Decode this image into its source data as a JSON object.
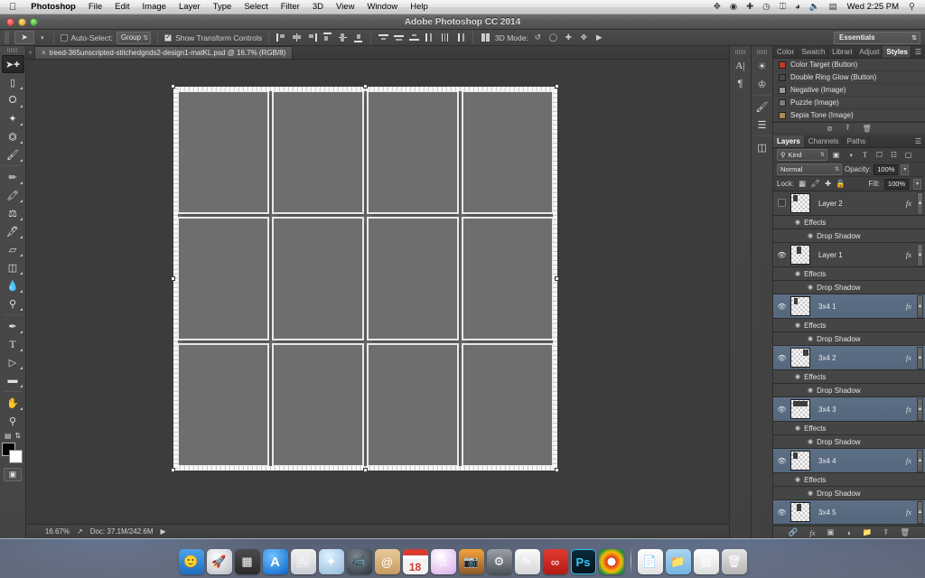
{
  "menubar": {
    "apple": "",
    "items": [
      "Photoshop",
      "File",
      "Edit",
      "Image",
      "Layer",
      "Type",
      "Select",
      "Filter",
      "3D",
      "View",
      "Window",
      "Help"
    ],
    "status_icons": [
      "dropbox-icon",
      "evernote-icon",
      "alfred-icon",
      "timemachine-icon",
      "bluetooth-icon",
      "wifi-icon",
      "volume-icon",
      "battery-icon"
    ],
    "clock": "Wed 2:25 PM",
    "search": "spotlight-search-icon"
  },
  "window": {
    "title": "Adobe Photoshop CC 2014"
  },
  "options_bar": {
    "tool_icon": "move-tool-icon",
    "auto_select_label": "Auto-Select:",
    "auto_select_value": "Group",
    "show_transform_label": "Show Transform Controls",
    "show_transform_checked": true,
    "align_buttons": [
      "align-left-edges",
      "align-horizontal-centers",
      "align-right-edges",
      "align-top-edges",
      "align-vertical-centers",
      "align-bottom-edges",
      "distribute-top-edges",
      "distribute-vertical-centers",
      "distribute-bottom-edges",
      "distribute-left-edges",
      "distribute-horizontal-centers",
      "distribute-right-edges"
    ],
    "mode_3d_label": "3D Mode:",
    "mode_3d_buttons": [
      "rotate-3d-icon",
      "roll-3d-icon",
      "drag-3d-icon",
      "slide-3d-icon",
      "scale-3d-camera-icon"
    ],
    "workspace": "Essentials"
  },
  "document": {
    "tab_title": "treed-365unscripted-stitchedgrids2-design1-matKL.psd @ 16.7% (RGB/8)",
    "close_icon": "close-tab-icon"
  },
  "status_bar": {
    "zoom": "16.67%",
    "share_icon": "share-icon",
    "doc_label": "Doc: 37.1M/242.6M",
    "arrow_icon": "status-expand-arrow-icon"
  },
  "toolbar": {
    "tools": [
      {
        "name": "move-tool",
        "glyph": "➤",
        "active": true
      },
      {
        "name": "rectangular-marquee-tool",
        "glyph": "▭",
        "active": false
      },
      {
        "name": "lasso-tool",
        "glyph": "⟳",
        "active": false
      },
      {
        "name": "quick-selection-tool",
        "glyph": "✦",
        "active": false
      },
      {
        "name": "crop-tool",
        "glyph": "⌗",
        "active": false
      },
      {
        "name": "eyedropper-tool",
        "glyph": "✒",
        "active": false
      },
      {
        "name": "spot-healing-brush-tool",
        "glyph": "✐",
        "active": false
      },
      {
        "name": "brush-tool",
        "glyph": "╱",
        "active": false
      },
      {
        "name": "clone-stamp-tool",
        "glyph": "⚓",
        "active": false
      },
      {
        "name": "history-brush-tool",
        "glyph": "✎",
        "active": false
      },
      {
        "name": "eraser-tool",
        "glyph": "▱",
        "active": false
      },
      {
        "name": "gradient-tool",
        "glyph": "◨",
        "active": false
      },
      {
        "name": "blur-tool",
        "glyph": "●",
        "active": false
      },
      {
        "name": "dodge-tool",
        "glyph": "⚲",
        "active": false
      },
      {
        "name": "pen-tool",
        "glyph": "✒",
        "active": false
      },
      {
        "name": "horizontal-type-tool",
        "glyph": "T",
        "active": false
      },
      {
        "name": "path-selection-tool",
        "glyph": "➤",
        "active": false
      },
      {
        "name": "rectangle-tool",
        "glyph": "▬",
        "active": false
      },
      {
        "name": "hand-tool",
        "glyph": "✋",
        "active": false
      },
      {
        "name": "zoom-tool",
        "glyph": "⌕",
        "active": false
      }
    ],
    "foreground_color": "#000000",
    "background_color": "#ffffff",
    "quick_mask": "quick-mask-mode-icon"
  },
  "minidock": {
    "col1": [
      "character-panel-icon",
      "paragraph-panel-icon"
    ],
    "col2": [
      "adjustments-panel-icon",
      "styles-panel-icon",
      "brush-panel-icon",
      "brush-presets-panel-icon",
      "3d-panel-icon"
    ]
  },
  "styles_panel": {
    "tabs": [
      "Color",
      "Swatch",
      "Librari",
      "Adjust",
      "Styles"
    ],
    "active_tab": "Styles",
    "menu_icon": "panel-menu-icon",
    "items": [
      {
        "label": "Color Target (Button)",
        "color": "#c0392b"
      },
      {
        "label": "Double Ring Glow (Button)",
        "color": "#4a4a4a"
      },
      {
        "label": "Negative (Image)",
        "color": "#9a9a9a"
      },
      {
        "label": "Puzzle (Image)",
        "color": "#7d7d7d"
      },
      {
        "label": "Sepia Tone (Image)",
        "color": "#b08b58"
      }
    ],
    "footer_icons": [
      "no-style-icon",
      "new-style-icon",
      "delete-style-icon"
    ]
  },
  "layers_panel": {
    "tabs": [
      "Layers",
      "Channels",
      "Paths"
    ],
    "active_tab": "Layers",
    "menu_icon": "panel-menu-icon",
    "filter_label": "Kind",
    "filter_icons": [
      "filter-pixel-icon",
      "filter-adjustment-icon",
      "filter-type-icon",
      "filter-shape-icon",
      "filter-smartobject-icon"
    ],
    "blend_mode": "Normal",
    "opacity_label": "Opacity:",
    "opacity_value": "100%",
    "lock_label": "Lock:",
    "lock_icons": [
      "lock-transparent-pixels-icon",
      "lock-image-pixels-icon",
      "lock-position-icon",
      "lock-all-icon"
    ],
    "fill_label": "Fill:",
    "fill_value": "100%",
    "effects_label": "Effects",
    "drop_shadow_label": "Drop Shadow",
    "fx_badge": "fx",
    "layers": [
      {
        "name": "Layer 2",
        "visible": false,
        "selected": false,
        "has_fx": true
      },
      {
        "name": "Layer 1",
        "visible": true,
        "selected": false,
        "has_fx": true
      },
      {
        "name": "3x4 1",
        "visible": true,
        "selected": true,
        "has_fx": true
      },
      {
        "name": "3x4 2",
        "visible": true,
        "selected": true,
        "has_fx": true
      },
      {
        "name": "3x4 3",
        "visible": true,
        "selected": true,
        "has_fx": true
      },
      {
        "name": "3x4 4",
        "visible": true,
        "selected": true,
        "has_fx": true
      },
      {
        "name": "3x4 5",
        "visible": true,
        "selected": true,
        "has_fx": true
      }
    ],
    "footer_icons": [
      "link-layers-icon",
      "add-layer-style-icon",
      "add-layer-mask-icon",
      "new-adjustment-layer-icon",
      "new-group-icon",
      "new-layer-icon",
      "delete-layer-icon"
    ]
  },
  "canvas": {
    "columns": 4,
    "rows": 3,
    "cell_color": "#6e6e6e",
    "border_style": "stitched-white",
    "selection_handles": 8
  },
  "dock": {
    "left_items": [
      {
        "name": "finder",
        "glyph": "🙂",
        "bg": "linear-gradient(180deg,#4aa3e8,#1d6fc0)",
        "running": true
      },
      {
        "name": "launchpad",
        "glyph": "🚀",
        "bg": "radial-gradient(circle at 40% 30%,#fdfdfd,#b9bcc2)",
        "running": false
      },
      {
        "name": "mission-control",
        "glyph": "▦",
        "bg": "linear-gradient(180deg,#4b4b4b,#2b2b2b)",
        "running": false
      },
      {
        "name": "app-store",
        "glyph": "A",
        "bg": "radial-gradient(circle at 38% 28%,#6fc3ff,#0a64c8)",
        "running": false
      },
      {
        "name": "preview",
        "glyph": "🖼",
        "bg": "linear-gradient(180deg,#f2f2f2,#c9ccd2)",
        "running": false
      },
      {
        "name": "safari",
        "glyph": "✦",
        "bg": "radial-gradient(circle at 38% 28%,#dff2ff,#8fb7d6)",
        "running": false
      },
      {
        "name": "facetime",
        "glyph": "📹",
        "bg": "radial-gradient(circle at 38% 28%,#7a8590,#2e3439)",
        "running": false
      },
      {
        "name": "contacts",
        "glyph": "@",
        "bg": "linear-gradient(180deg,#e8c99b,#c79a5e)",
        "running": false
      },
      {
        "name": "calendar",
        "glyph": "18",
        "bg": "linear-gradient(180deg,#ffffff 38%,#f2f2f2 38%)",
        "running": false
      },
      {
        "name": "itunes",
        "glyph": "♫",
        "bg": "radial-gradient(circle at 38% 28%,#ffffff,#d9a8e8)",
        "running": false
      },
      {
        "name": "iphoto",
        "glyph": "📷",
        "bg": "linear-gradient(180deg,#f6a23c,#8a5a2c)",
        "running": false
      },
      {
        "name": "system-preferences",
        "glyph": "⚙",
        "bg": "linear-gradient(180deg,#9aa0a6,#4c5257)",
        "running": false
      },
      {
        "name": "textedit",
        "glyph": "✎",
        "bg": "linear-gradient(180deg,#fbfbfb,#d6d6d6)",
        "running": false
      },
      {
        "name": "creative-cloud",
        "glyph": "∞",
        "bg": "linear-gradient(180deg,#e03a32,#b31b15)",
        "running": false
      },
      {
        "name": "photoshop",
        "glyph": "Ps",
        "bg": "linear-gradient(180deg,#0a2a3a,#04161f)",
        "running": true
      },
      {
        "name": "google-chrome",
        "glyph": "●",
        "bg": "radial-gradient(circle at 50% 50%,#ffffff 22%,#d93025 23%,#fbbc04 55%,#1e8e3e 80%)",
        "running": true
      }
    ],
    "right_items": [
      {
        "name": "document-file",
        "glyph": "📄",
        "bg": "linear-gradient(180deg,#ffffff,#e2e2e2)",
        "running": false
      },
      {
        "name": "downloads-folder",
        "glyph": "📁",
        "bg": "linear-gradient(180deg,#a9d5f2,#72b4e0)",
        "running": false
      },
      {
        "name": "spreadsheet-file",
        "glyph": "▤",
        "bg": "linear-gradient(180deg,#ffffff,#dcdcdc)",
        "running": false
      },
      {
        "name": "trash",
        "glyph": "🗑",
        "bg": "linear-gradient(180deg,#e4e4e4,#b5b5b5)",
        "running": false
      }
    ],
    "separator": "dock-separator"
  }
}
